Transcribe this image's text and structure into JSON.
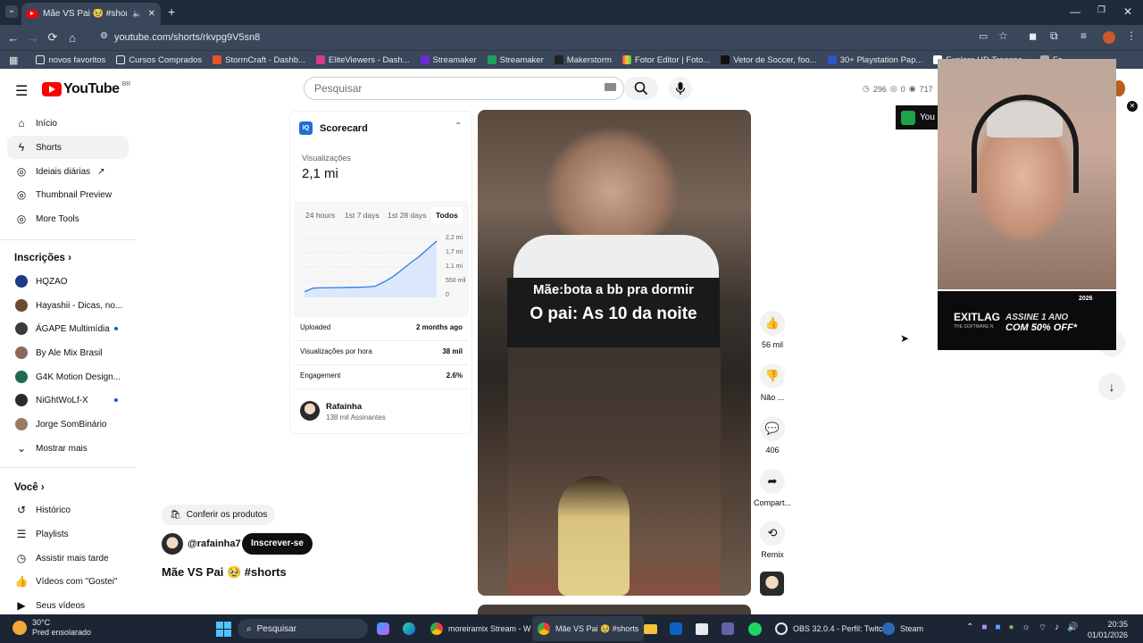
{
  "browser": {
    "tab_title": "Mãe VS Pai 🥹 #shorts - Yo",
    "url": "youtube.com/shorts/rkvpg9V5sn8",
    "bookmarks": [
      "novos favoritos",
      "Cursos Comprados",
      "StormCraft - Dashb...",
      "EliteViewers - Dash...",
      "Streamaker",
      "Streamaker",
      "Makerstorm",
      "Fotor Editor | Foto...",
      "Vetor de Soccer, foo...",
      "30+ Playstation Pap...",
      "Explore HD Transpa...",
      "Fo..."
    ]
  },
  "header": {
    "logo_text": "YouTube",
    "country": "BR",
    "search_placeholder": "Pesquisar",
    "stats": {
      "views": "296",
      "hidden": "0",
      "watch": "717"
    }
  },
  "sidebar": {
    "items": [
      {
        "label": "Início"
      },
      {
        "label": "Shorts"
      },
      {
        "label": "Ideiais diárias"
      },
      {
        "label": "Thumbnail Preview"
      },
      {
        "label": "More Tools"
      }
    ],
    "subs_title": "Inscrições",
    "subs": [
      {
        "label": "HQZAO",
        "color": "#1b3a8a"
      },
      {
        "label": "Hayashii - Dicas, no...",
        "color": "#6d4b2f"
      },
      {
        "label": "ÁGAPE Multimídia",
        "color": "#3b3b3b",
        "dot": true
      },
      {
        "label": "By Ale Mix Brasil",
        "color": "#8a6a5a"
      },
      {
        "label": "G4K Motion Design...",
        "color": "#1f6b52"
      },
      {
        "label": "NiGhtWoLf-X",
        "color": "#2e2a33",
        "dot": true
      },
      {
        "label": "Jorge SomBinário",
        "color": "#9a7b62"
      }
    ],
    "show_more": "Mostrar mais",
    "you_title": "Você",
    "you": [
      {
        "label": "Histórico"
      },
      {
        "label": "Playlists"
      },
      {
        "label": "Assistir mais tarde"
      },
      {
        "label": "Vídeos com \"Gostei\""
      },
      {
        "label": "Seus vídeos"
      }
    ]
  },
  "scorecard": {
    "title": "Scorecard",
    "views_label": "Visualizações",
    "views_value": "2,1 mi",
    "ranges": [
      "24 hours",
      "1st 7 days",
      "1st 28 days",
      "Todos"
    ],
    "active_range": "Todos",
    "y_ticks": [
      "2,2 mi",
      "1,7 mi",
      "1,1 mi",
      "550 mil",
      "0"
    ],
    "rows": [
      {
        "label": "Uploaded",
        "value": "2 months ago"
      },
      {
        "label": "Visualizações por hora",
        "value": "38 mil"
      },
      {
        "label": "Engagement",
        "value": "2.6%"
      }
    ],
    "channel_name": "Rafainha",
    "channel_subs": "138 mil Assinantes"
  },
  "chart_data": {
    "type": "area",
    "y_range": [
      0,
      2200000
    ],
    "values": [
      150000,
      290000,
      300000,
      305000,
      310000,
      315000,
      320000,
      330000,
      360000,
      520000,
      720000,
      980000,
      1250000,
      1500000,
      1800000,
      2100000
    ]
  },
  "video": {
    "caption_line1": "Mãe:bota a bb pra dormir",
    "caption_line2": "O pai:   As 10 da noite",
    "products_label": "Conferir os produtos",
    "channel_handle": "@rafainha7",
    "subscribe_label": "Inscrever-se",
    "title": "Mãe VS Pai 🥹 #shorts"
  },
  "actions": {
    "likes": "56 mil",
    "dislike": "Não ...",
    "comments": "406",
    "share": "Compart...",
    "remix": "Remix"
  },
  "overlay": {
    "you_badge": "You",
    "ad_line1": "EXITLAG",
    "ad_line2": "THE SOFTWARE N",
    "ad_line3": "ASSINE 1 ANO",
    "ad_line4": "COM 50% OFF*",
    "ad_year": "2026"
  },
  "taskbar": {
    "weather_temp": "30°C",
    "weather_desc": "Pred ensolarado",
    "search": "Pesquisar",
    "apps": [
      {
        "label": "moreiramix Stream - W"
      },
      {
        "label": "Mãe VS Pai 🥹 #shorts"
      },
      {
        "label": "OBS 32.0.4 - Perfil: Twitc"
      },
      {
        "label": "Steam"
      }
    ],
    "time": "20:35",
    "date": "01/01/2026"
  }
}
